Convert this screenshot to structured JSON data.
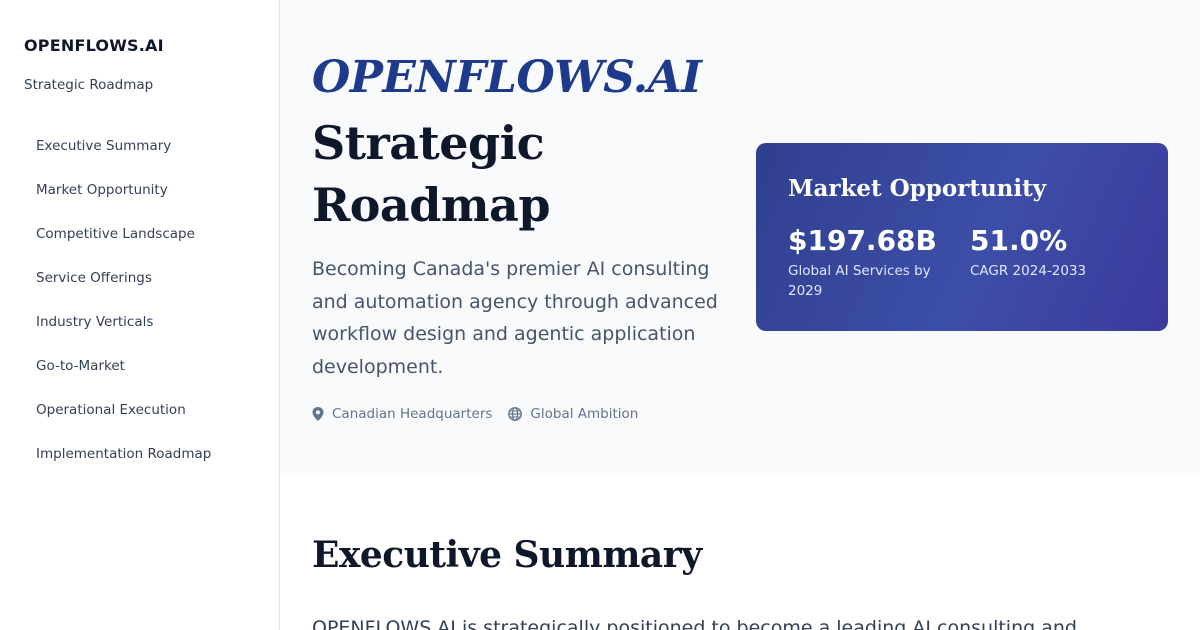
{
  "sidebar": {
    "brand": "OPENFLOWS.AI",
    "subtitle": "Strategic Roadmap",
    "items": [
      {
        "label": "Executive Summary"
      },
      {
        "label": "Market Opportunity"
      },
      {
        "label": "Competitive Landscape"
      },
      {
        "label": "Service Offerings"
      },
      {
        "label": "Industry Verticals"
      },
      {
        "label": "Go-to-Market"
      },
      {
        "label": "Operational Execution"
      },
      {
        "label": "Implementation Roadmap"
      }
    ]
  },
  "hero": {
    "brand": "OPENFLOWS.AI",
    "title": "Strategic Roadmap",
    "description": "Becoming Canada's premier AI consulting and automation agency through advanced workflow design and agentic application development.",
    "meta": [
      {
        "icon": "map-pin-icon",
        "label": "Canadian Headquarters"
      },
      {
        "icon": "globe-icon",
        "label": "Global Ambition"
      }
    ]
  },
  "market_card": {
    "title": "Market Opportunity",
    "stats": [
      {
        "value": "$197.68B",
        "label": "Global AI Services by 2029"
      },
      {
        "value": "51.0%",
        "label": "CAGR 2024-2033"
      }
    ]
  },
  "executive_summary": {
    "title": "Executive Summary",
    "text": "OPENFLOWS.AI is strategically positioned to become a leading AI consulting and"
  },
  "colors": {
    "accent": "#1e3a8a",
    "card_gradient_start": "#2f3f8f",
    "card_gradient_end": "#3b3a9c",
    "heading": "#0f172a",
    "muted": "#64748b"
  }
}
